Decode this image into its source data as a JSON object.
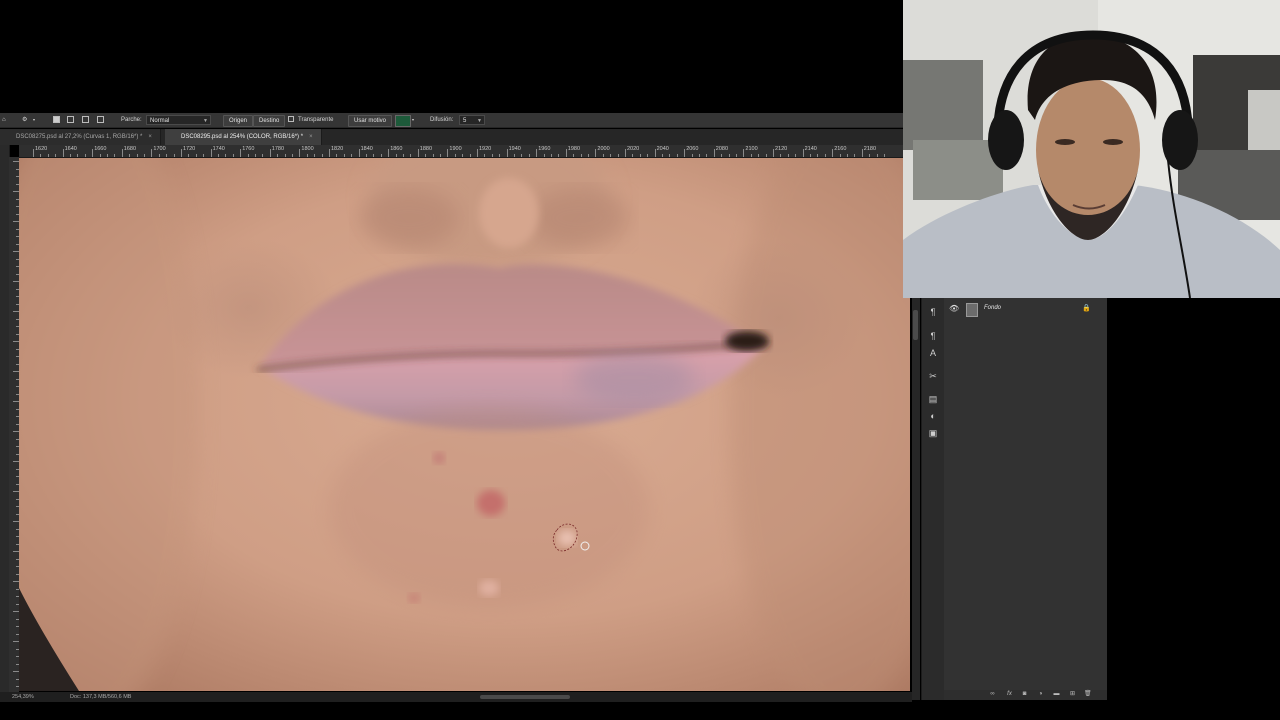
{
  "options_bar": {
    "patch_label": "Parche:",
    "patch_mode": "Normal",
    "source_button": "Origen",
    "destination_button": "Destino",
    "transparent_label": "Transparente",
    "use_pattern_button": "Usar motivo",
    "diffusion_label": "Difusión:",
    "diffusion_value": "5"
  },
  "tabs": [
    {
      "label": "DSC08275.psd al 27,2% (Curvas 1, RGB/16*) *",
      "active": false,
      "close": "×"
    },
    {
      "label": "DSC08295.psd al 254% (COLOR, RGB/16*) *",
      "active": true,
      "close": "×"
    }
  ],
  "ruler": {
    "labels": [
      "1620",
      "1640",
      "1660",
      "1680",
      "1700",
      "1720",
      "1740",
      "1760",
      "1780",
      "1800",
      "1820",
      "1840",
      "1860",
      "1880",
      "1900",
      "1920",
      "1940",
      "1960",
      "1980",
      "2000",
      "2020",
      "2040",
      "2060",
      "2080",
      "2100",
      "2120",
      "2140",
      "2160",
      "2180"
    ]
  },
  "status": {
    "zoom": "254,39%",
    "doc_size": "Doc: 137,3 MB/560,6 MB"
  },
  "layers": {
    "name": "Fondo",
    "visible_icon": "eye-icon",
    "lock_icon": "lock-icon"
  },
  "panel_icons": [
    "paragraph-icon",
    "character-style-icon",
    "paragraph-style-icon",
    "tools-icon",
    "libraries-icon",
    "adjustments-icon",
    "properties-icon"
  ],
  "layers_footer_icons": [
    "link-icon",
    "fx-icon",
    "mask-icon",
    "adjustment-layer-icon",
    "group-icon",
    "new-layer-icon",
    "trash-icon"
  ],
  "colors": {
    "panel_bg": "#323232",
    "options_bg": "#353535",
    "skin": "#d2a38a",
    "lip": "#c98e93"
  }
}
